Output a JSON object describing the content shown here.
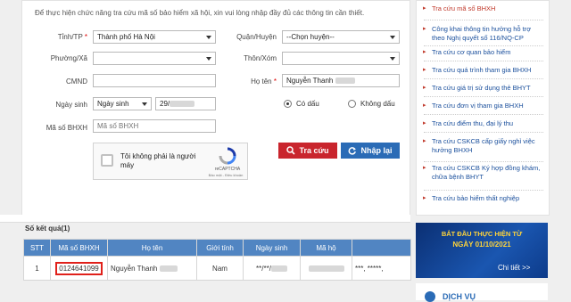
{
  "form": {
    "intro": "Để thực hiện chức năng tra cứu mã số bảo hiểm xã hội, xin vui lòng nhập đầy đủ các thông tin cần thiết.",
    "province_label": "Tỉnh/TP",
    "province_value": "Thành phố Hà Nội",
    "district_label": "Quận/Huyện",
    "district_value": "--Chọn huyện--",
    "ward_label": "Phường/Xã",
    "village_label": "Thôn/Xóm",
    "id_label": "CMND",
    "name_label": "Họ tên",
    "name_value": "Nguyễn Thanh",
    "dob_label": "Ngày sinh",
    "dob_type": "Ngày sinh",
    "dob_value": "29/",
    "accent_on": "Có dấu",
    "accent_off": "Không dấu",
    "bhxh_label": "Mã số BHXH",
    "bhxh_placeholder": "Mã số BHXH",
    "required_mark": "*"
  },
  "captcha": {
    "text": "Tôi không phải là người máy",
    "brand": "reCAPTCHA",
    "terms": "Bảo mật - Điều khoản"
  },
  "buttons": {
    "search": "Tra cứu",
    "reset": "Nhập lại"
  },
  "sidebar": {
    "items": [
      "Tra cứu mã số BHXH",
      "Công khai thông tin hưởng hỗ trợ theo Nghị quyết số 116/NQ-CP",
      "Tra cứu cơ quan bảo hiểm",
      "Tra cứu quá trình tham gia BHXH",
      "Tra cứu giá trị sử dụng thẻ BHYT",
      "Tra cứu đơn vị tham gia BHXH",
      "Tra cứu điểm thu, đại lý thu",
      "Tra cứu CSKCB cấp giấy nghỉ việc hưởng BHXH",
      "Tra cứu CSKCB Ký hợp đồng khám, chữa bệnh BHYT",
      "Tra cứu bảo hiểm thất nghiệp"
    ],
    "banner_line1": "BẮT ĐẦU THỰC HIỆN TỪ",
    "banner_line2": "NGÀY 01/10/2021",
    "banner_link": "Chi tiết >>",
    "next_heading": "DỊCH VỤ"
  },
  "results": {
    "count_label": "Số kết quả(1)",
    "columns": [
      "STT",
      "Mã số BHXH",
      "Họ tên",
      "Giới tính",
      "Ngày sinh",
      "Mã hộ",
      ""
    ],
    "rows": [
      [
        "1",
        "0124641099",
        "Nguyễn Thanh",
        "Nam",
        "**/**/",
        "",
        "***, *****,"
      ]
    ]
  },
  "colors": {
    "table_header": "#5185c2",
    "search_button": "#c9252d",
    "reset_button": "#2a6bb6",
    "link": "#1a4f9c",
    "highlight_box": "#e0201a"
  }
}
